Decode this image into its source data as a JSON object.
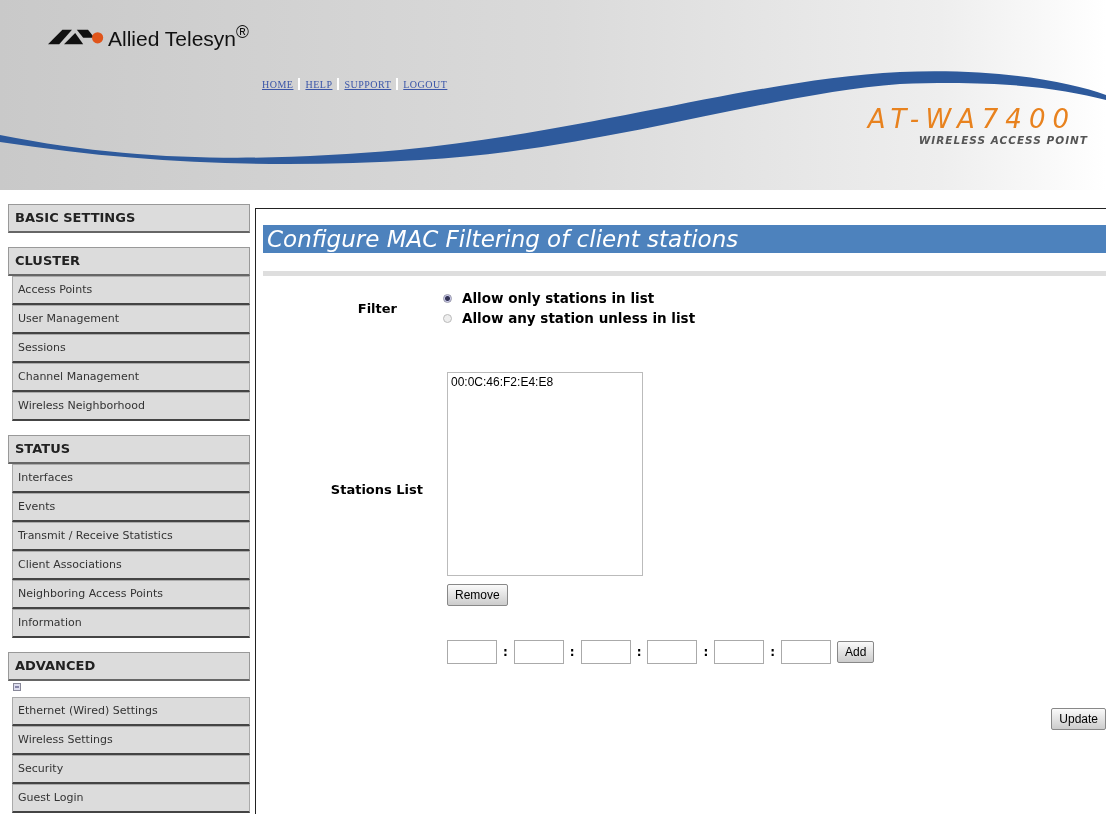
{
  "header": {
    "brand": "Allied Telesyn$^{®}$",
    "links": [
      {
        "label": "HOME"
      },
      {
        "label": "HELP"
      },
      {
        "label": "SUPPORT"
      },
      {
        "label": "LOGOUT"
      }
    ],
    "product": "AT-WA7400",
    "product_subtitle": "WIRELESS ACCESS POINT"
  },
  "sidebar": {
    "sections": [
      {
        "title": "BASIC SETTINGS"
      },
      {
        "title": "CLUSTER",
        "items": [
          {
            "label": "Access Points"
          },
          {
            "label": "User Management"
          },
          {
            "label": "Sessions"
          },
          {
            "label": "Channel Management"
          },
          {
            "label": "Wireless Neighborhood"
          }
        ]
      },
      {
        "title": "STATUS",
        "items": [
          {
            "label": "Interfaces"
          },
          {
            "label": "Events"
          },
          {
            "label": "Transmit / Receive Statistics"
          },
          {
            "label": "Client Associations"
          },
          {
            "label": "Neighboring Access Points"
          },
          {
            "label": "Information"
          }
        ]
      },
      {
        "title": "ADVANCED",
        "collapse_toggle": true,
        "items": [
          {
            "label": "Ethernet (Wired) Settings"
          },
          {
            "label": "Wireless Settings"
          },
          {
            "label": "Security"
          },
          {
            "label": "Guest Login"
          }
        ]
      }
    ]
  },
  "page": {
    "title": "Configure MAC Filtering of client stations",
    "filter": {
      "label": "Filter",
      "options": [
        {
          "label": "Allow only stations in list",
          "selected": true
        },
        {
          "label": "Allow any station unless in list",
          "selected": false
        }
      ]
    },
    "stations": {
      "label": "Stations List",
      "entries": [
        "00:0C:46:F2:E4:E8"
      ],
      "remove_button": "Remove"
    },
    "mac_octets": [
      {
        "kind": "octet",
        "separator": ":"
      },
      {
        "kind": "octet",
        "separator": ":"
      },
      {
        "kind": "octet",
        "separator": ":"
      },
      {
        "kind": "octet",
        "separator": ":"
      },
      {
        "kind": "octet",
        "separator": ":"
      },
      {
        "kind": "octet"
      }
    ],
    "add_button": "Add",
    "update_button": "Update"
  }
}
